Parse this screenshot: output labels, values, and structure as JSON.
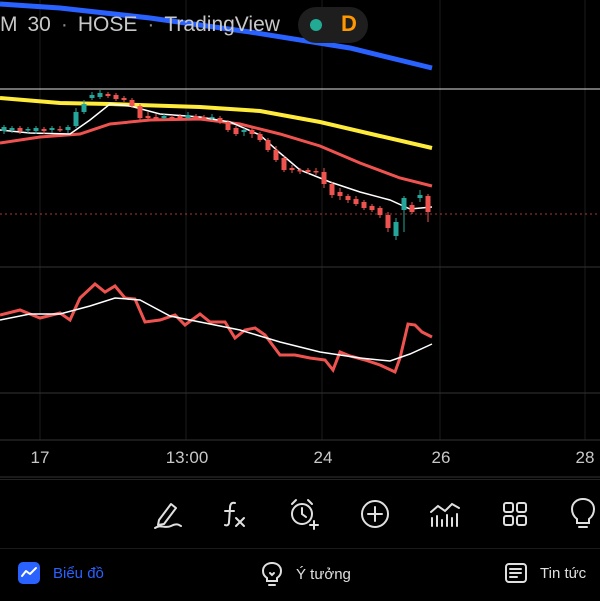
{
  "header": {
    "timeframe_prefix": "M",
    "interval": "30",
    "exchange": "HOSE",
    "provider": "TradingView",
    "status_letter": "D"
  },
  "time_axis": {
    "ticks": [
      "17",
      "13:00",
      "24",
      "26",
      "28"
    ]
  },
  "colors": {
    "background": "#000000",
    "candle_up": "#26a69a",
    "candle_down": "#ef5350",
    "ma_blue": "#2962ff",
    "ma_yellow": "#ffeb3b",
    "ma_red": "#ef5350",
    "ma_white": "#ffffff",
    "accent": "#2962ff",
    "status_orange": "#ff9800"
  },
  "toolbar": {
    "icons": [
      "pencil-icon",
      "function-icon",
      "alarm-add-icon",
      "plus-circle-icon",
      "volume-bars-icon",
      "grid-icon",
      "lightbulb-icon"
    ]
  },
  "bottom_nav": {
    "chart_label": "Biểu đồ",
    "ideas_label": "Ý tưởng",
    "news_label": "Tin tức"
  }
}
